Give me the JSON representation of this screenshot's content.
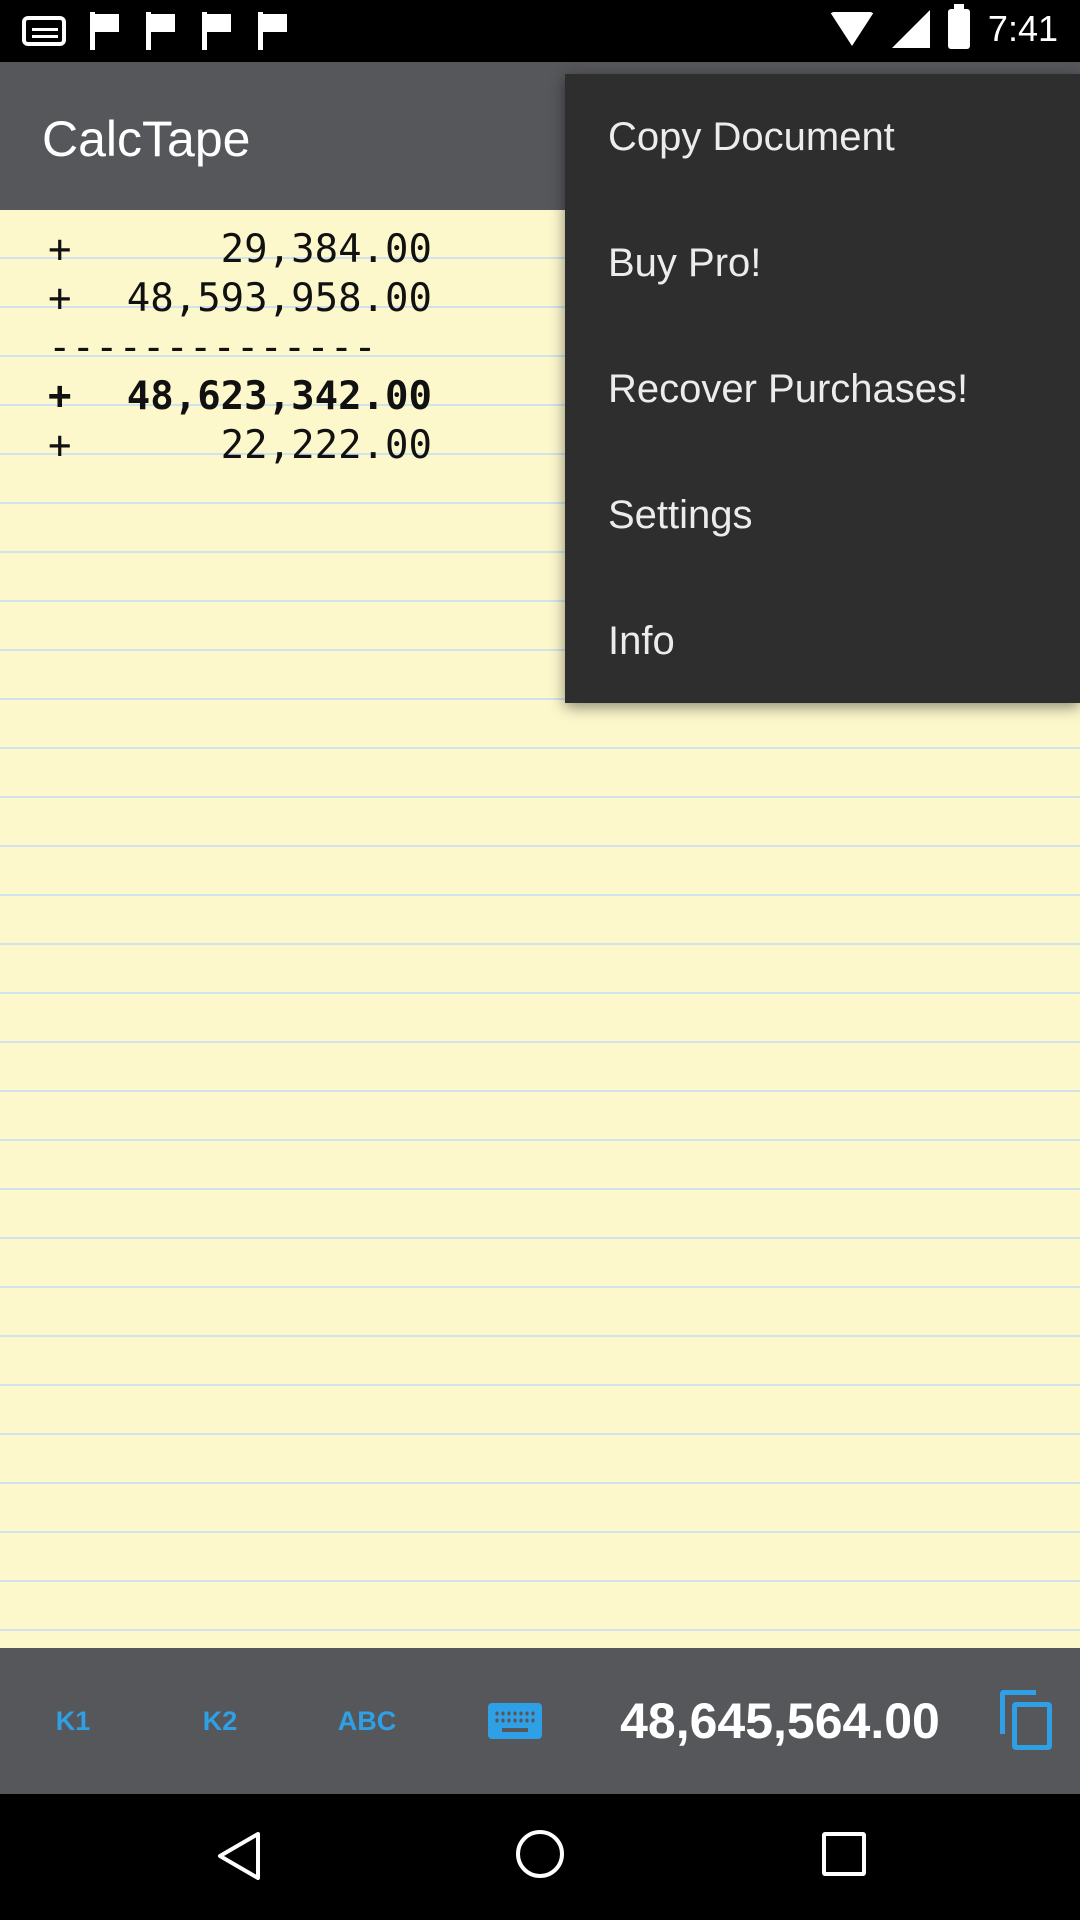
{
  "status_bar": {
    "time": "7:41"
  },
  "app": {
    "title": "CalcTape"
  },
  "tape": {
    "lines": [
      {
        "op": "+",
        "value": "29,384.00",
        "bold": false
      },
      {
        "op": "+",
        "value": "48,593,958.00",
        "bold": false
      },
      {
        "op": "",
        "value": "--------------",
        "separator": true
      },
      {
        "op": "+",
        "value": "48,623,342.00",
        "bold": true
      },
      {
        "op": "+",
        "value": "22,222.00",
        "bold": false
      }
    ]
  },
  "menu": {
    "items": [
      {
        "label": "Copy Document"
      },
      {
        "label": "Buy Pro!"
      },
      {
        "label": "Recover Purchases!"
      },
      {
        "label": "Settings"
      },
      {
        "label": "Info"
      }
    ]
  },
  "toolbar": {
    "k1_label": "K1",
    "k2_label": "K2",
    "abc_label": "ABC",
    "keyboard_icon": "keyboard-icon",
    "total": "48,645,564.00",
    "copy_icon": "copy-icon"
  },
  "colors": {
    "accent": "#2f9fe6",
    "app_bar": "#56575b",
    "paper": "#fdf8cc",
    "menu_bg": "#2e2e2e"
  }
}
